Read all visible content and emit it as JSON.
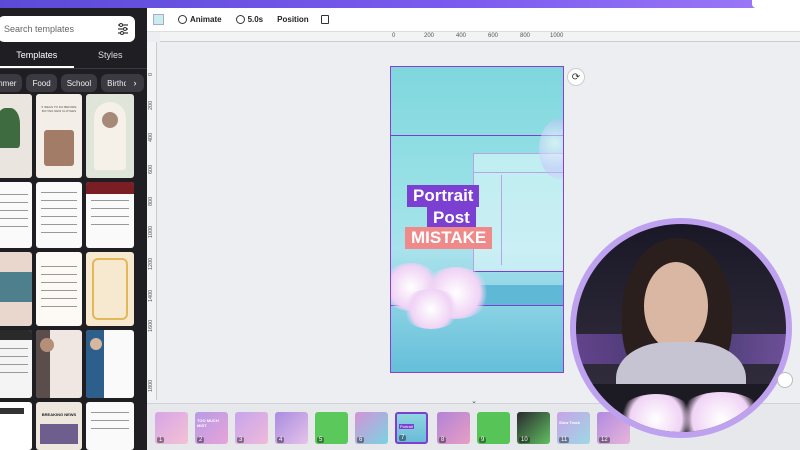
{
  "left_panel": {
    "search_placeholder": "Search templates",
    "tabs": [
      "Templates",
      "Styles"
    ],
    "chips": [
      "mmer",
      "Food",
      "School",
      "Birthday"
    ],
    "chip_next": "›"
  },
  "toolbar": {
    "animate_label": "Animate",
    "duration_label": "5.0s",
    "position_label": "Position",
    "swatch_color": "#c8eef0"
  },
  "ruler": {
    "top_ticks": [
      "0",
      "200",
      "400",
      "600",
      "800",
      "1000"
    ],
    "left_ticks": [
      "0",
      "200",
      "400",
      "600",
      "800",
      "1000",
      "1200",
      "1400",
      "1600",
      "1800"
    ]
  },
  "canvas": {
    "title_line_1": "Portrait",
    "title_line_2": "Post",
    "title_line_3": "MISTAKE",
    "accent_purple": "#7b3fd1",
    "accent_pink": "#f08a8a"
  },
  "filmstrip": {
    "page_numbers": [
      "1",
      "2",
      "3",
      "4",
      "5",
      "6",
      "7",
      "8",
      "9",
      "10",
      "11",
      "12"
    ],
    "thumb_texts": [
      "",
      "TOO MUCH MIST",
      "",
      "",
      "",
      "",
      "Portrait",
      "",
      "",
      "",
      "Slow Track",
      ""
    ]
  },
  "template_thumbs": {
    "t1_title": "5 IDEAS TO DO BEFORE BUYING NEW CLOTHES",
    "t2_title": "BREAKING NEWS"
  }
}
